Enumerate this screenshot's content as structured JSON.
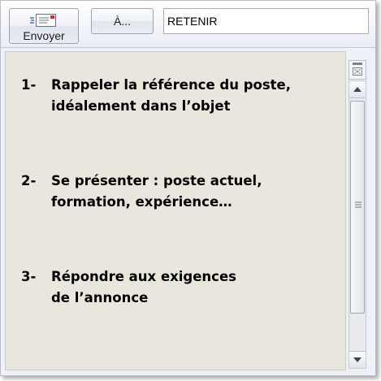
{
  "toolbar": {
    "send_label": "Envoyer",
    "to_label": "À...",
    "subject_value": "RETENIR"
  },
  "body": {
    "points": [
      {
        "number": "1-",
        "text": "Rappeler la référence du poste,\nidéalement dans l’objet"
      },
      {
        "number": "2-",
        "text": "Se présenter : poste actuel,\nformation, expérience…"
      },
      {
        "number": "3-",
        "text": "Répondre aux exigences\nde l’annonce"
      }
    ],
    "background_color": "#e9e7dd"
  },
  "icons": {
    "send": "send-mail-icon",
    "collapse": "window-collapse-icon",
    "scroll_up": "triangle-up-icon",
    "scroll_down": "triangle-down-icon",
    "grip": "scroll-grip-icon"
  }
}
